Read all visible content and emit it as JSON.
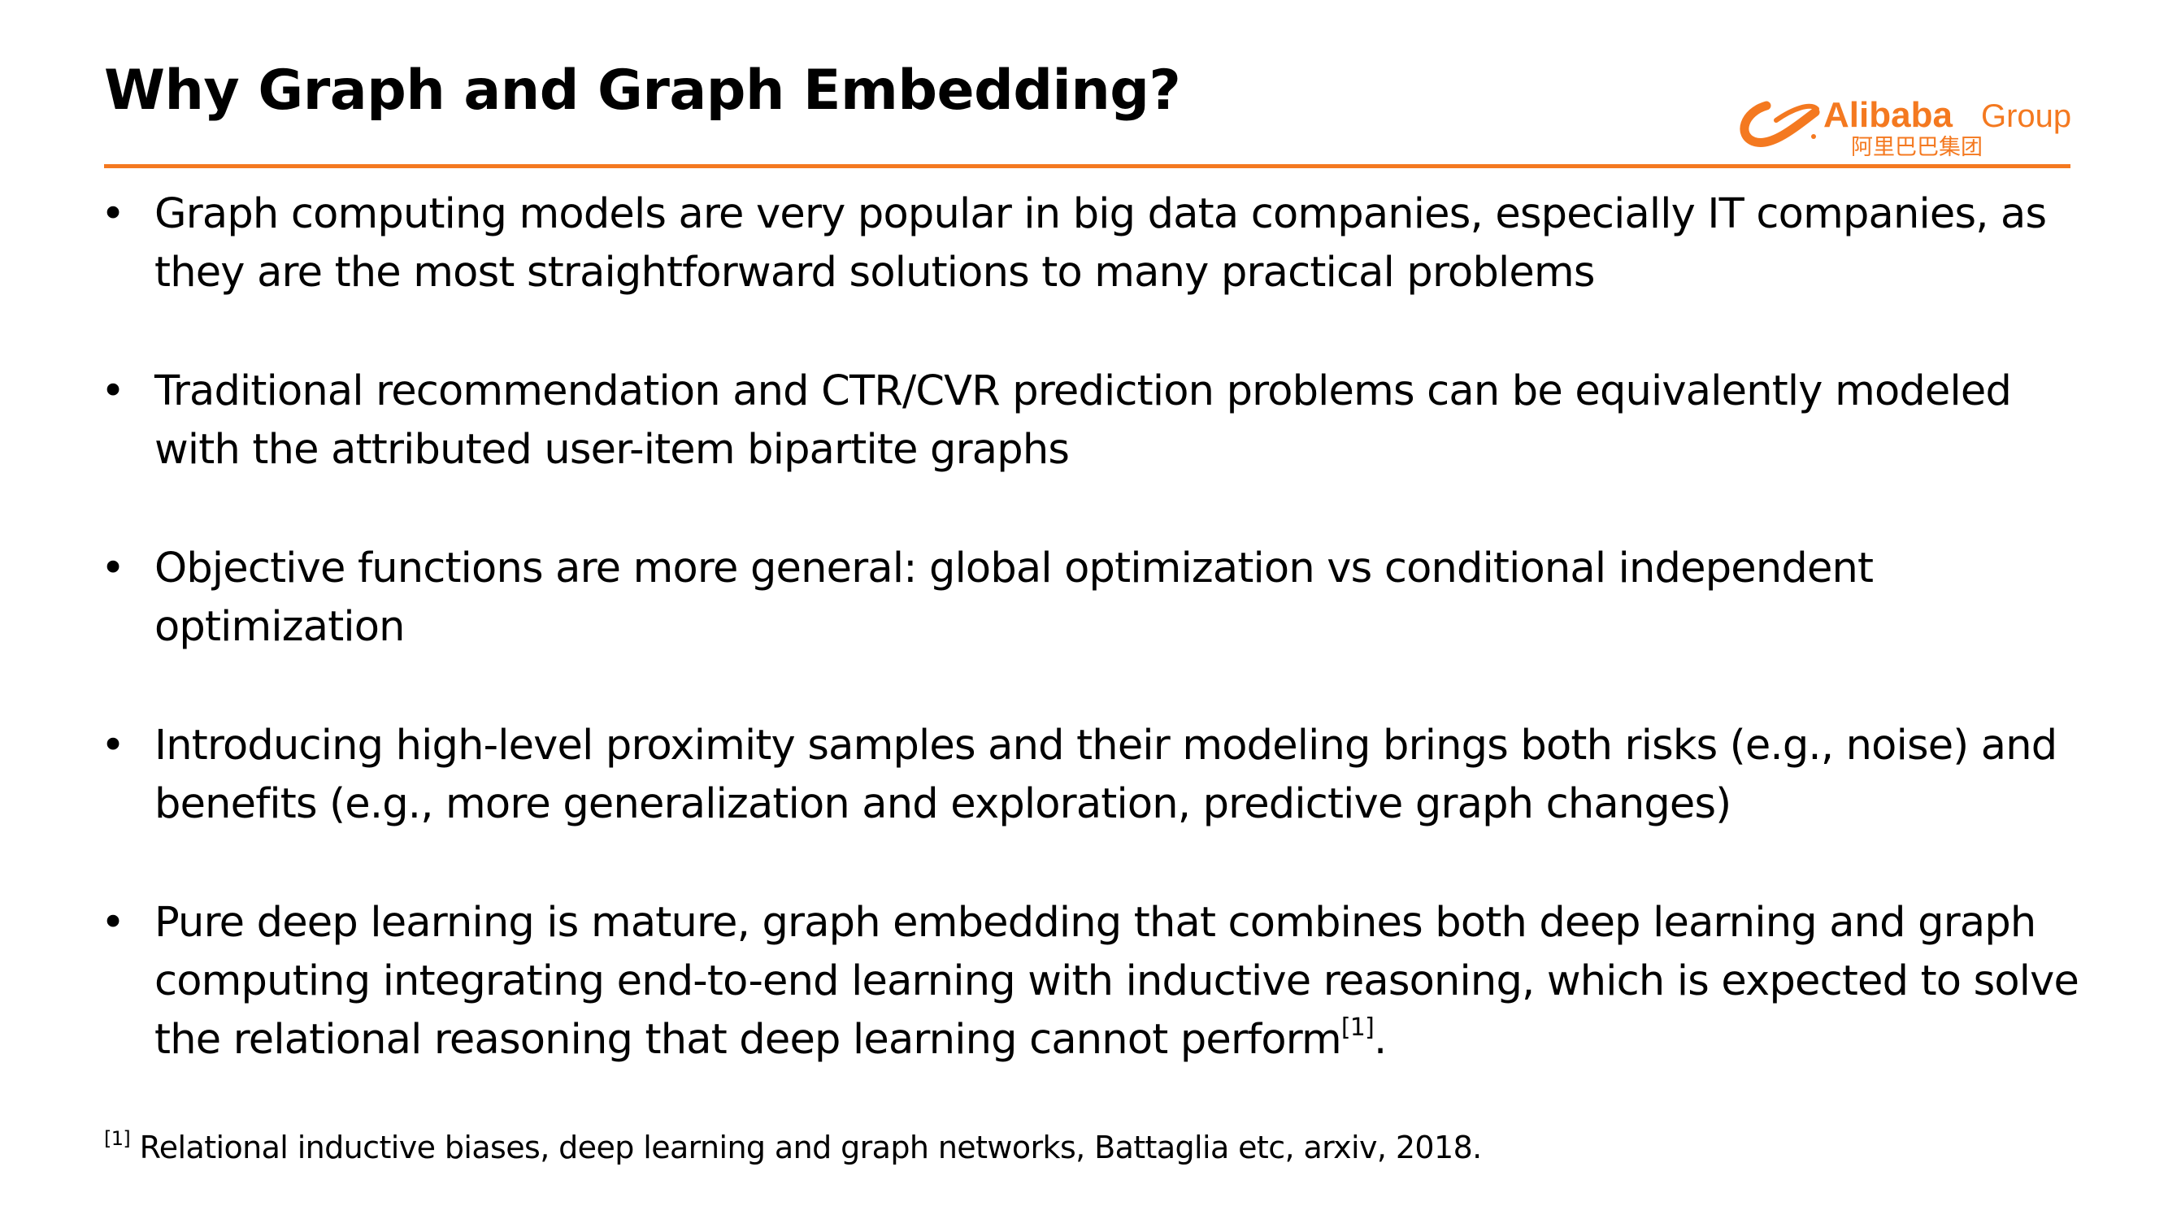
{
  "slide": {
    "title": "Why Graph and Graph Embedding?",
    "accent_color": "#F47920",
    "logo": {
      "icon": "alibaba-smile-logo-icon",
      "name": "Alibaba",
      "group": "Group",
      "chinese": "阿里巴巴集团"
    },
    "bullets": [
      {
        "marker": "•",
        "text": "Graph computing models are very popular in big data companies, especially IT companies, as they are the most straightforward solutions to many practical problems"
      },
      {
        "marker": "•",
        "text": "Traditional recommendation and CTR/CVR prediction problems can be equivalently modeled with the attributed user-item bipartite graphs"
      },
      {
        "marker": "•",
        "text": "Objective functions are more general:  global optimization vs conditional independent optimization"
      },
      {
        "marker": "•",
        "text": "Introducing high-level proximity samples and their modeling brings both risks (e.g., noise) and benefits (e.g., more generalization and exploration, predictive graph changes)"
      },
      {
        "marker": "•",
        "text": "Pure deep learning is mature, graph embedding that combines both deep learning and graph computing integrating end-to-end learning with inductive reasoning, which is expected to solve the relational reasoning that deep learning cannot perform",
        "ref": "[1]",
        "trail": "."
      }
    ],
    "footnote": {
      "ref": "[1]",
      "text": " Relational inductive biases, deep learning and graph networks, Battaglia etc, arxiv, 2018."
    }
  }
}
